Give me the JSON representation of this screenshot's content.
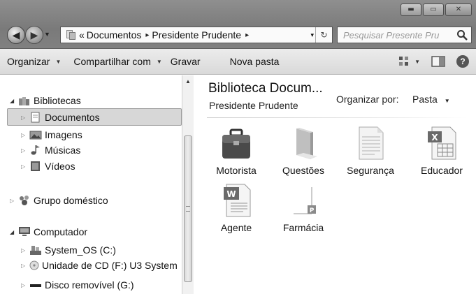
{
  "window": {
    "controls": {
      "minimize_icon": "minimize-icon",
      "maximize_icon": "maximize-icon",
      "close_icon": "close-icon"
    }
  },
  "addressbar": {
    "overflow_chevron": "«",
    "crumbs": [
      "Documentos",
      "Presidente Prudente"
    ],
    "separator": "▸",
    "dropdown_glyph": "▾",
    "refresh_glyph": "↻"
  },
  "search": {
    "placeholder": "Pesquisar Presente Pru"
  },
  "toolbar": {
    "organizar": "Organizar",
    "compartilhar": "Compartilhar com",
    "gravar": "Gravar",
    "nova_pasta": "Nova pasta",
    "dropdown_glyph": "▼"
  },
  "navpane": {
    "bibliotecas": "Bibliotecas",
    "documentos": "Documentos",
    "imagens": "Imagens",
    "musicas": "Músicas",
    "videos": "Vídeos",
    "grupo": "Grupo doméstico",
    "computador": "Computador",
    "system_os": "System_OS (C:)",
    "cd": "Unidade de CD (F:) U3 System",
    "removivel": "Disco removível (G:)"
  },
  "library": {
    "title": "Biblioteca Docum...",
    "subtitle": "Presidente Prudente",
    "arrange_label": "Organizar por:",
    "arrange_value": "Pasta"
  },
  "files": [
    {
      "name": "Motorista",
      "icon": "briefcase-icon"
    },
    {
      "name": "Questões",
      "icon": "folder-icon"
    },
    {
      "name": "Segurança",
      "icon": "text-document-icon"
    },
    {
      "name": "Educador",
      "icon": "excel-document-icon"
    },
    {
      "name": "Agente",
      "icon": "word-document-icon"
    },
    {
      "name": "Farmácia",
      "icon": "publisher-document-icon"
    }
  ],
  "colors": {
    "titlebar": "#808080",
    "toolbar": "#e0e0e0",
    "selection": "#d7d7d7"
  }
}
